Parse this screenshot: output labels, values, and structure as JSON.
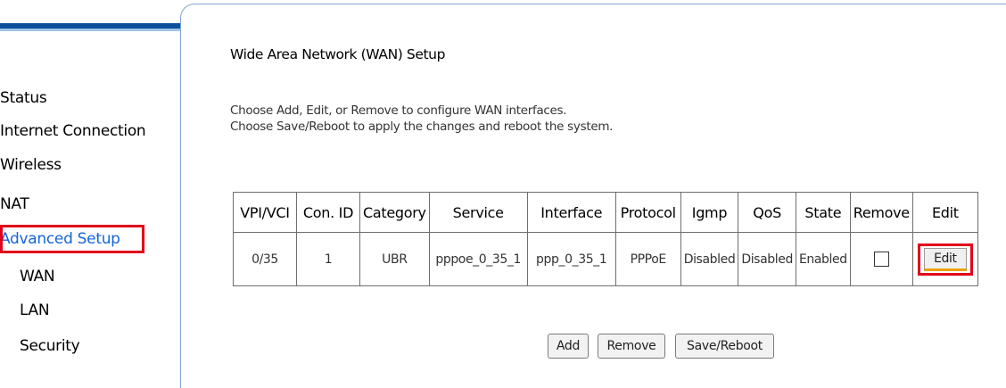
{
  "sidebar": {
    "items": [
      {
        "label": "Status"
      },
      {
        "label": "Internet Connection"
      },
      {
        "label": "Wireless"
      },
      {
        "label": "NAT"
      },
      {
        "label": "Advanced Setup"
      },
      {
        "label": "WAN"
      },
      {
        "label": "LAN"
      },
      {
        "label": "Security"
      }
    ],
    "active": "Advanced Setup"
  },
  "main": {
    "title": "Wide Area Network (WAN) Setup",
    "description_1": "Choose Add, Edit, or Remove to configure WAN interfaces.",
    "description_2": "Choose Save/Reboot to apply the changes and reboot the system."
  },
  "table": {
    "headers": [
      "VPI/VCI",
      "Con. ID",
      "Category",
      "Service",
      "Interface",
      "Protocol",
      "Igmp",
      "QoS",
      "State",
      "Remove",
      "Edit"
    ],
    "rows": [
      {
        "vpi_vci": "0/35",
        "con_id": "1",
        "category": "UBR",
        "service": "pppoe_0_35_1",
        "interface": "ppp_0_35_1",
        "protocol": "PPPoE",
        "igmp": "Disabled",
        "qos": "Disabled",
        "state": "Enabled",
        "remove_checked": false,
        "edit_label": "Edit"
      }
    ]
  },
  "buttons": {
    "add": "Add",
    "remove": "Remove",
    "save_reboot": "Save/Reboot"
  },
  "colors": {
    "highlight": "#e0001a",
    "active_link": "#1565d8",
    "sidebar_bar": "#0a4f9c"
  }
}
